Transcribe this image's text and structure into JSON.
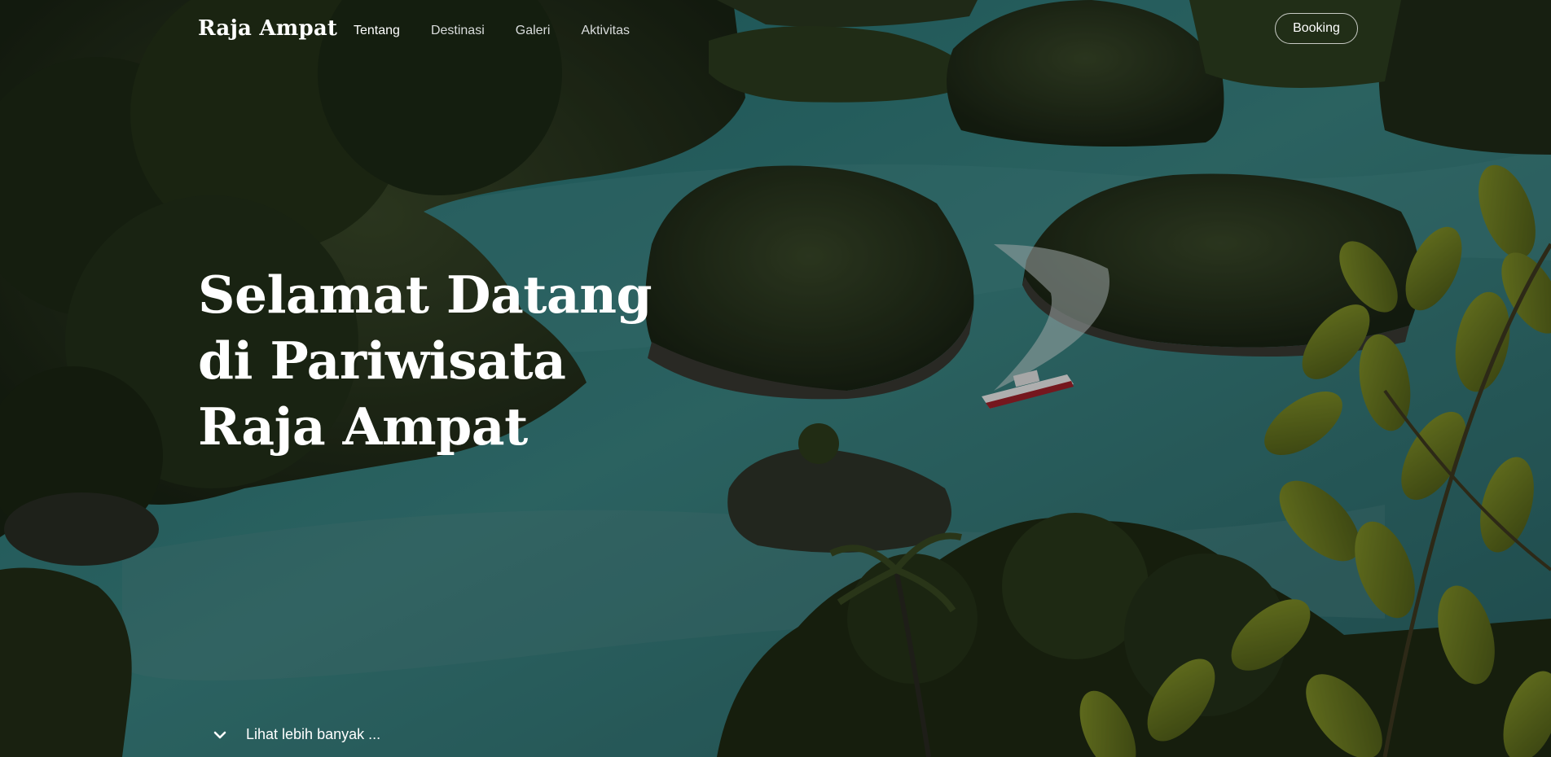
{
  "header": {
    "brand": "Raja Ampat",
    "nav": [
      {
        "label": "Tentang",
        "active": true
      },
      {
        "label": "Destinasi",
        "active": false
      },
      {
        "label": "Galeri",
        "active": false
      },
      {
        "label": "Aktivitas",
        "active": false
      }
    ],
    "booking_label": "Booking"
  },
  "hero": {
    "title": "Selamat Datang di Pariwisata Raja Ampat",
    "see_more_label": "Lihat lebih banyak ..."
  },
  "icons": {
    "scroll": "chevron-down-icon"
  },
  "colors": {
    "text": "#ffffff",
    "water": "#2e7b7a",
    "foliage": "#2b3a1f",
    "overlay": "rgba(0,0,0,0.28)"
  }
}
